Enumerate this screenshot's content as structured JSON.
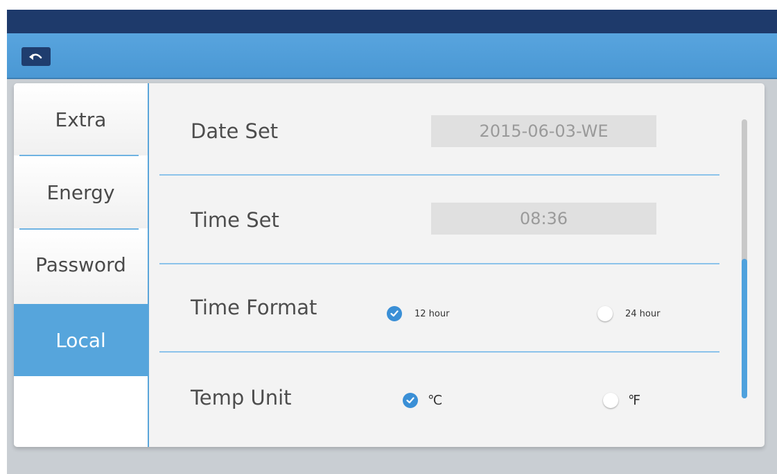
{
  "header": {
    "back_icon": "back-arrow-icon"
  },
  "sidebar": {
    "items": [
      {
        "label": "Extra",
        "active": false
      },
      {
        "label": "Energy",
        "active": false
      },
      {
        "label": "Password",
        "active": false
      },
      {
        "label": "Local",
        "active": true
      }
    ]
  },
  "settings": {
    "date_set": {
      "label": "Date Set",
      "value": "2015-06-03-WE"
    },
    "time_set": {
      "label": "Time Set",
      "value": "08:36"
    },
    "time_format": {
      "label": "Time Format",
      "options": [
        {
          "label": "12 hour",
          "checked": true
        },
        {
          "label": "24 hour",
          "checked": false
        }
      ]
    },
    "temp_unit": {
      "label": "Temp Unit",
      "options": [
        {
          "label": "℃",
          "checked": true
        },
        {
          "label": "℉",
          "checked": false
        }
      ]
    }
  },
  "scrollbar": {
    "position_fraction": 0.5,
    "visible_fraction": 0.5
  },
  "colors": {
    "accent": "#56a5dc",
    "header": "#4a98d4",
    "top_strip": "#1e3a6b",
    "check": "#3a8fd6"
  }
}
